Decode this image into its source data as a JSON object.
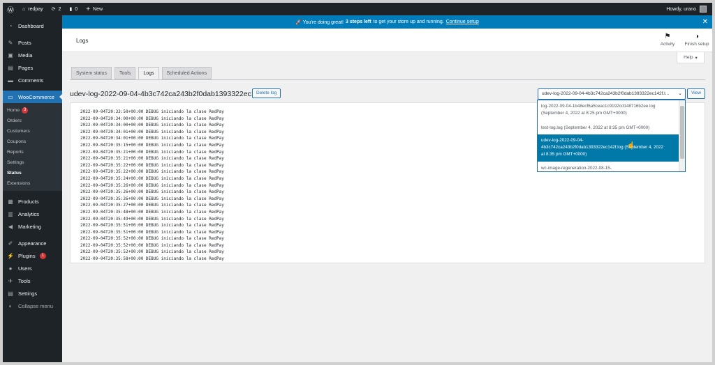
{
  "admin_bar": {
    "site_name": "redpay",
    "updates_count": "2",
    "comments_count": "0",
    "new_label": "New",
    "greeting": "Howdy, urano"
  },
  "sidebar": {
    "dashboard": "Dashboard",
    "posts": "Posts",
    "media": "Media",
    "pages": "Pages",
    "comments": "Comments",
    "woocommerce": "WooCommerce",
    "wc_sub": {
      "home": "Home",
      "home_badge": "3",
      "orders": "Orders",
      "customers": "Customers",
      "coupons": "Coupons",
      "reports": "Reports",
      "settings": "Settings",
      "status": "Status",
      "extensions": "Extensions"
    },
    "products": "Products",
    "analytics": "Analytics",
    "marketing": "Marketing",
    "appearance": "Appearance",
    "plugins": "Plugins",
    "plugins_badge": "1",
    "users": "Users",
    "tools": "Tools",
    "settings": "Settings",
    "collapse": "Collapse menu"
  },
  "notice": {
    "prefix": "🚀 You're doing great!",
    "bold": "3 steps left",
    "middle": "to get your store up and running.",
    "link": "Continue setup"
  },
  "header": {
    "title": "Logs",
    "activity": "Activity",
    "finish_setup": "Finish setup",
    "help": "Help"
  },
  "tabs": {
    "system_status": "System status",
    "tools": "Tools",
    "logs": "Logs",
    "scheduled_actions": "Scheduled Actions"
  },
  "log": {
    "title": "udev-log-2022-09-04-4b3c742ca243b2f0dab1393322ec142f.log",
    "delete_label": "Delete log",
    "view_label": "View",
    "selected_value": "udev-log-2022-09-04-4b3c742ca243b2f0dab1393322ec142f.l...",
    "lines": [
      "2022-09-04T20:33:50+00:00 DEBUG iniciando la clase RedPay",
      "2022-09-04T20:34:00+00:00 DEBUG iniciando la clase RedPay",
      "2022-09-04T20:34:00+00:00 DEBUG iniciando la clase RedPay",
      "2022-09-04T20:34:01+00:00 DEBUG iniciando la clase RedPay",
      "2022-09-04T20:34:01+00:00 DEBUG iniciando la clase RedPay",
      "2022-09-04T20:35:15+00:00 DEBUG iniciando la clase RedPay",
      "2022-09-04T20:35:21+00:00 DEBUG iniciando la clase RedPay",
      "2022-09-04T20:35:21+00:00 DEBUG iniciando la clase RedPay",
      "2022-09-04T20:35:22+00:00 DEBUG iniciando la clase RedPay",
      "2022-09-04T20:35:22+00:00 DEBUG iniciando la clase RedPay",
      "2022-09-04T20:35:24+00:00 DEBUG iniciando la clase RedPay",
      "2022-09-04T20:35:26+00:00 DEBUG iniciando la clase RedPay",
      "2022-09-04T20:35:26+00:00 DEBUG iniciando la clase RedPay",
      "2022-09-04T20:35:26+00:00 DEBUG iniciando la clase RedPay",
      "2022-09-04T20:35:27+00:00 DEBUG iniciando la clase RedPay",
      "2022-09-04T20:35:48+00:00 DEBUG iniciando la clase RedPay",
      "2022-09-04T20:35:49+00:00 DEBUG iniciando la clase RedPay",
      "2022-09-04T20:35:51+00:00 DEBUG iniciando la clase RedPay",
      "2022-09-04T20:35:51+00:00 DEBUG iniciando la clase RedPay",
      "2022-09-04T20:35:52+00:00 DEBUG iniciando la clase RedPay",
      "2022-09-04T20:35:52+00:00 DEBUG iniciando la clase RedPay",
      "2022-09-04T20:35:52+00:00 DEBUG iniciando la clase RedPay",
      "2022-09-04T20:35:58+00:00 DEBUG iniciando la clase RedPay"
    ]
  },
  "dropdown": {
    "opt1_l1": "log-2022-09-04-1b48ecf6a5ceac1c9192cd148716b2ee.log",
    "opt1_l2": "(September 4, 2022 at 8:25 pm GMT+0000)",
    "opt2": "test-log.log (September 4, 2022 at 8:35 pm GMT+0000)",
    "opt3_l1": "udev-log-2022-09-04-",
    "opt3_l2": "4b3c742ca243b2f0dab1393322ec142f.log (September 4, 2022",
    "opt3_l3": "at 8:35 pm GMT+0000)",
    "opt4": "wc-image-regeneration-2022-08-15-"
  },
  "colors": {
    "accent": "#2271b1",
    "notice_bg": "#007cba",
    "sidebar_bg": "#1d2327",
    "selected_option": "#0078a8"
  },
  "icons": [
    "wordpress-icon",
    "home-icon",
    "updates-icon",
    "comment-icon",
    "plus-icon",
    "dashboard-icon",
    "pin-icon",
    "media-icon",
    "page-icon",
    "comments-icon",
    "woo-icon",
    "products-icon",
    "analytics-icon",
    "marketing-icon",
    "appearance-icon",
    "plugins-icon",
    "users-icon",
    "tools-icon",
    "settings-icon",
    "collapse-icon",
    "flag-icon",
    "half-circle-icon",
    "close-icon"
  ]
}
